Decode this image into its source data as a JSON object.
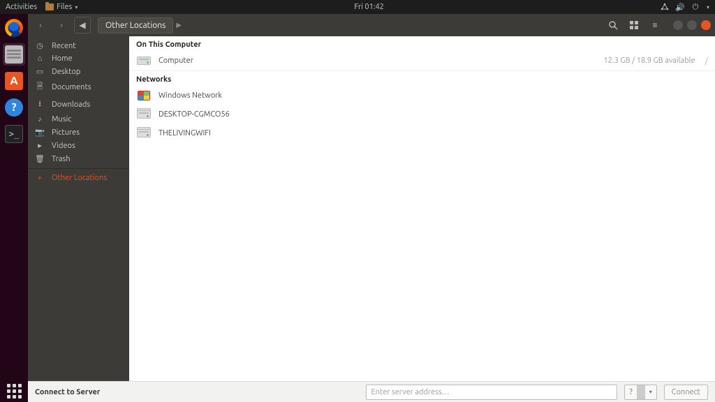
{
  "topbar": {
    "activities": "Activities",
    "app_name": "Files",
    "clock": "Fri 01:42"
  },
  "window": {
    "breadcrumb": "Other Locations"
  },
  "sidebar": {
    "items": [
      {
        "label": "Recent"
      },
      {
        "label": "Home"
      },
      {
        "label": "Desktop"
      },
      {
        "label": "Documents"
      },
      {
        "label": "Downloads"
      },
      {
        "label": "Music"
      },
      {
        "label": "Pictures"
      },
      {
        "label": "Videos"
      },
      {
        "label": "Trash"
      }
    ],
    "other_locations": "Other Locations"
  },
  "content": {
    "section_computer": "On This Computer",
    "computer_row": {
      "label": "Computer",
      "meta": "12.3 GB / 18.9 GB available",
      "mount": "/"
    },
    "section_networks": "Networks",
    "network_rows": [
      {
        "label": "Windows Network"
      },
      {
        "label": "DESKTOP-CGMCO56"
      },
      {
        "label": "THELIVINGWIFI"
      }
    ]
  },
  "footer": {
    "label": "Connect to Server",
    "placeholder": "Enter server address…",
    "connect": "Connect",
    "hint": "?"
  }
}
